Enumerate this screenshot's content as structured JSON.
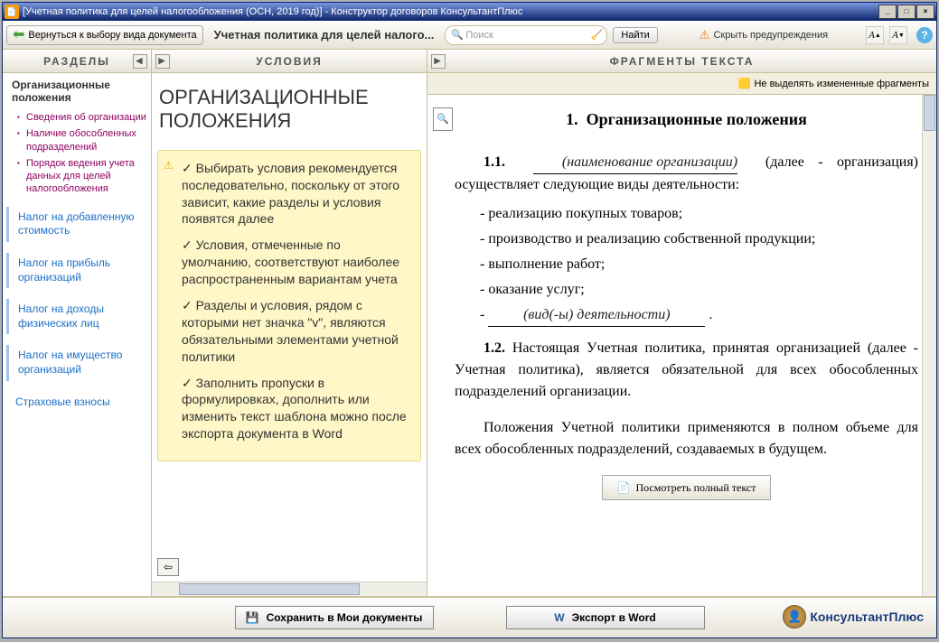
{
  "window": {
    "title": "[Учетная политика для целей налогообложения (ОСН, 2019 год)] - Конструктор договоров КонсультантПлюс"
  },
  "toolbar": {
    "back": "Вернуться к выбору вида документа",
    "doc_title": "Учетная политика для целей налого...",
    "search_placeholder": "Поиск",
    "find": "Найти",
    "hide_warnings": "Скрыть предупреждения"
  },
  "sections": {
    "header": "РАЗДЕЛЫ",
    "active": "Организационные положения",
    "subitems": [
      "Сведения об организации",
      "Наличие обособленных подразделений",
      "Порядок ведения учета данных для целей налогообложения"
    ],
    "links": [
      "Налог на добавленную стоимость",
      "Налог на прибыль организаций",
      "Налог на доходы физических лиц",
      "Налог на имущество организаций",
      "Страховые взносы"
    ]
  },
  "conditions": {
    "header": "УСЛОВИЯ",
    "title": "ОРГАНИЗАЦИОННЫЕ ПОЛОЖЕНИЯ",
    "tips": [
      "Выбирать условия рекомендуется последовательно, поскольку от этого зависит, какие разделы и условия появятся далее",
      "Условия, отмеченные по умолчанию, соответствуют наиболее распространенным вариантам учета",
      "Разделы и условия, рядом с которыми нет значка \"v\", являются обязательными элементами учетной политики",
      "Заполнить пропуски в формулировках, дополнить или изменить текст шаблона можно после экспорта документа в Word"
    ]
  },
  "fragments": {
    "header": "ФРАГМЕНТЫ ТЕКСТА",
    "highlight_label": "Не выделять измененные фрагменты",
    "heading_num": "1.",
    "heading": "Организационные положения",
    "p11_num": "1.1.",
    "p11_fill": "(наименование организации)",
    "p11_after": " (далее - организация) осуществляет следующие виды деятельности:",
    "list": [
      "реализацию покупных товаров;",
      "производство и реализацию собственной продукции;",
      "выполнение работ;",
      "оказание услуг;",
      "(вид(-ы) деятельности)"
    ],
    "p12_num": "1.2. ",
    "p12_text": "Настоящая Учетная политика, принятая организацией (далее - Учетная политика), является обязательной для всех обособленных подразделений организации.",
    "p_extra": "Положения Учетной политики  применяются в полном объеме для  всех обособленных подразделений, создаваемых в будущем.",
    "view_full": "Посмотреть полный текст"
  },
  "footer": {
    "save": "Сохранить в Мои документы",
    "export": "Экспорт в Word",
    "brand": "КонсультантПлюс"
  }
}
